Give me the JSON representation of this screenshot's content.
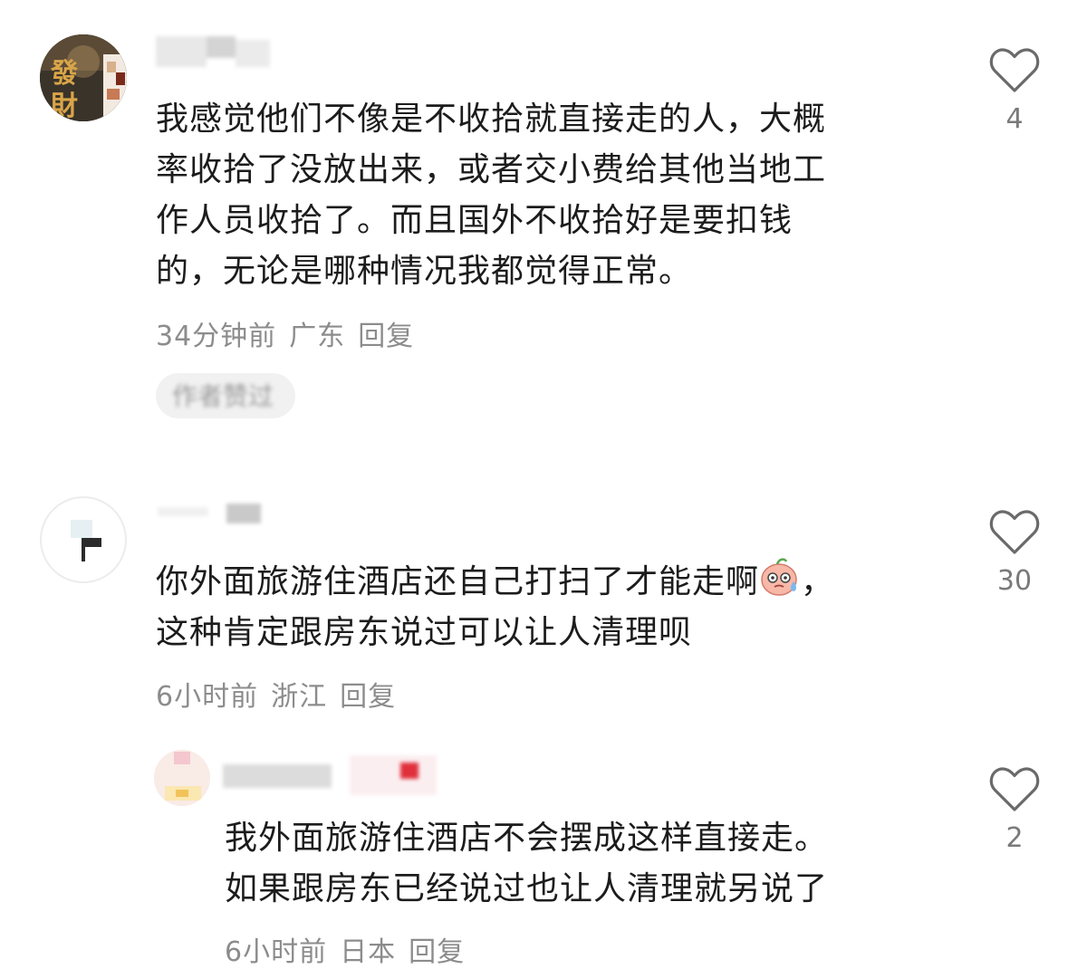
{
  "comments": [
    {
      "text": "我感觉他们不像是不收拾就直接走的人，大概\n率收拾了没放出来，或者交小费给其他当地工\n作人员收拾了。而且国外不收拾好是要扣钱\n的，无论是哪种情况我都觉得正常。",
      "time": "34分钟前",
      "location": "广东",
      "reply_label": "回复",
      "likes": "4",
      "author_badge": "作者赞过",
      "avatar_text": "發財"
    },
    {
      "text_before_emoji": "你外面旅游住酒店还自己打扫了才能走啊",
      "text_after_emoji": "，\n这种肯定跟房东说过可以让人清理呗",
      "emoji_icon": "sweating-face-emoji",
      "time": "6小时前",
      "location": "浙江",
      "reply_label": "回复",
      "likes": "30"
    },
    {
      "text": "我外面旅游住酒店不会摆成这样直接走。\n如果跟房东已经说过也让人清理就另说了",
      "time": "6小时前",
      "location": "日本",
      "reply_label": "回复",
      "likes": "2"
    }
  ],
  "icons": {
    "like": "heart-outline-icon"
  },
  "colors": {
    "text": "#1c1c1c",
    "meta": "#8c8c8c",
    "icon": "#666666"
  }
}
